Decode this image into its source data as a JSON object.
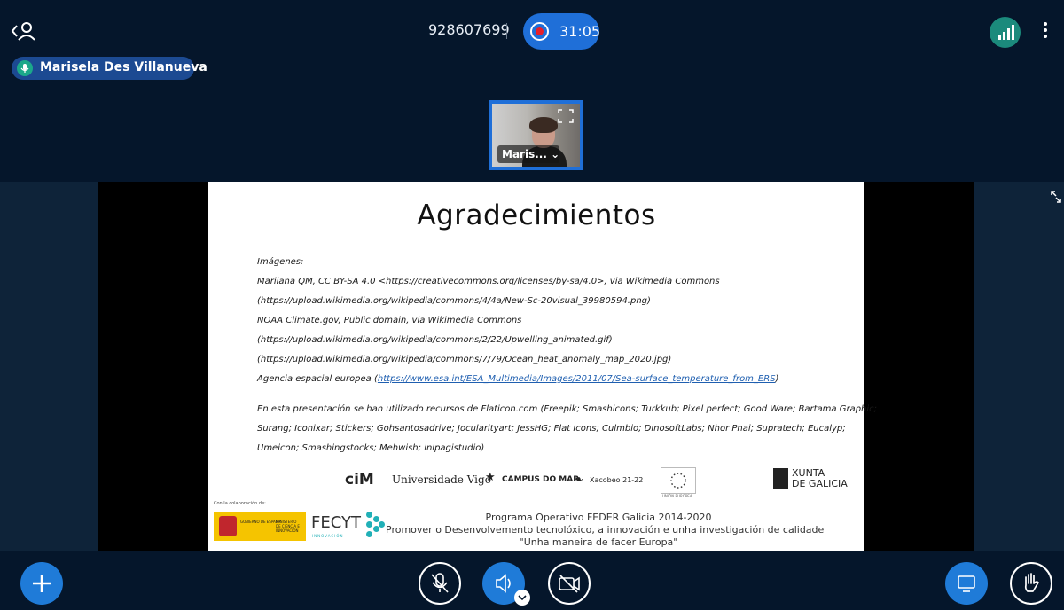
{
  "header": {
    "meeting_id": "928607699",
    "record_timer": "31:05"
  },
  "speaker": {
    "name": "Marisela Des Villanueva"
  },
  "webcam": {
    "label": "Maris..."
  },
  "slide": {
    "title": "Agradecimientos",
    "lines": [
      "Imágenes:",
      "Mariiana QM, CC BY-SA 4.0 <https://creativecommons.org/licenses/by-sa/4.0>, via Wikimedia Commons",
      "(https://upload.wikimedia.org/wikipedia/commons/4/4a/New-Sc-20visual_39980594.png)",
      "NOAA Climate.gov, Public domain, via Wikimedia Commons",
      "(https://upload.wikimedia.org/wikipedia/commons/2/22/Upwelling_animated.gif)",
      "(https://upload.wikimedia.org/wikipedia/commons/7/79/Ocean_heat_anomaly_map_2020.jpg)"
    ],
    "agency_prefix": "Agencia espacial europea (",
    "agency_link": "https://www.esa.int/ESA_Multimedia/Images/2011/07/Sea-surface_temperature_from_ERS",
    "agency_suffix": ")",
    "credits": [
      "En esta presentación se han utilizado recursos de Flaticon.com (Freepik; Smashicons; Turkkub; Pixel perfect; Good Ware; Bartama Graphic;",
      "Surang; Iconixar; Stickers; Gohsantosadrive; Jocularityart; JessHG; Flat Icons; Culmbio; DinosoftLabs; Nhor Phai; Supratech; Eucalyp;",
      "Umeicon; Smashingstocks; Mehwish; inipagistudio)"
    ],
    "logos": {
      "cim": "ciM",
      "uvigo": "Universidade Vigo",
      "campus": "CAMPUS DO MAR",
      "xacobeo": "Xacobeo 21-22",
      "eu": "UNIÓN EUROPEA",
      "xunta_1": "XUNTA",
      "xunta_2": "DE GALICIA",
      "collab": "Con la colaboración de:",
      "gov": "GOBIERNO DE ESPAÑA",
      "ministry": "MINISTERIO DE CIENCIA E INNOVACIÓN",
      "fecyt": "FECYT",
      "fecyt_sub": "INNOVACIÓN"
    },
    "footer": [
      "Programa Operativo FEDER Galicia 2014-2020",
      "Promover o Desenvolvemento tecnolóxico, a innovación e unha investigación de calidade",
      "\"Unha maneira de facer Europa\""
    ]
  },
  "colors": {
    "background": "#05162b",
    "accent": "#1f7bd8",
    "record": "#e8202a",
    "signal": "#1b8a7c"
  }
}
